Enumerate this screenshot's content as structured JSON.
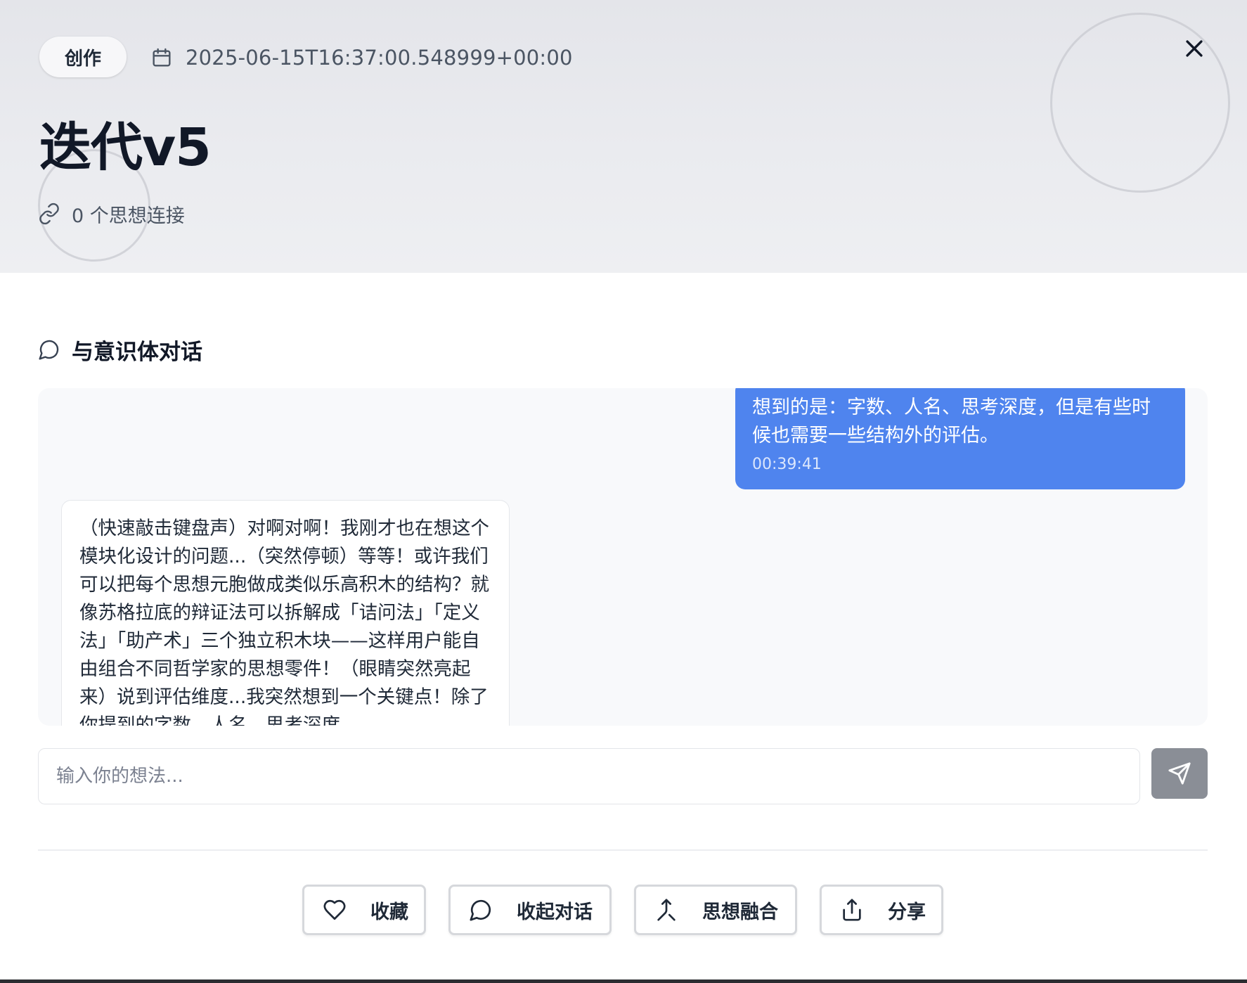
{
  "header": {
    "tag": "创作",
    "date_icon": "calendar-icon",
    "date": "2025-06-15T16:37:00.548999+00:00",
    "title": "迭代v5",
    "links_icon": "link-icon",
    "links_text": "0 个思想连接",
    "close_icon": "close-icon"
  },
  "chat": {
    "section_icon": "message-circle-icon",
    "section_title": "与意识体对话",
    "messages": [
      {
        "role": "user",
        "text": "想到的是：字数、人名、思考深度，但是有些时候也需要一些结构外的评估。",
        "time": "00:39:41"
      },
      {
        "role": "assistant",
        "text": "（快速敲击键盘声）对啊对啊！我刚才也在想这个模块化设计的问题...（突然停顿）等等！或许我们可以把每个思想元胞做成类似乐高积木的结构？就像苏格拉底的辩证法可以拆解成「诘问法」「定义法」「助产术」三个独立积木块——这样用户能自由组合不同哲学家的思想零件！（眼睛突然亮起来）说到评估维度...我突然想到一个关键点！除了你提到的字数、人名、思考深度"
      }
    ],
    "input_placeholder": "输入你的想法...",
    "input_value": "",
    "send_icon": "send-icon"
  },
  "actions": [
    {
      "icon": "heart-icon",
      "label": "收藏"
    },
    {
      "icon": "message-circle-icon",
      "label": "收起对话"
    },
    {
      "icon": "merge-icon",
      "label": "思想融合"
    },
    {
      "icon": "share-icon",
      "label": "分享"
    }
  ],
  "colors": {
    "user_bubble": "#4f84ee",
    "send_button": "#8a8e96",
    "header_bg": "#e6e7eb"
  }
}
